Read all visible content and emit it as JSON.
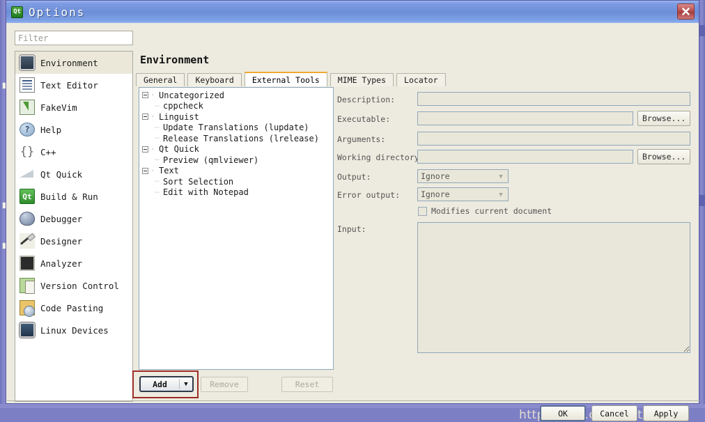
{
  "window": {
    "title": "Options",
    "app_icon": "qt-logo-icon",
    "close_label": "close-icon"
  },
  "sidebar": {
    "filter": {
      "placeholder": "Filter",
      "value": ""
    },
    "items": [
      {
        "label": "Environment",
        "icon": "environment-icon",
        "selected": true
      },
      {
        "label": "Text Editor",
        "icon": "text-editor-icon",
        "selected": false
      },
      {
        "label": "FakeVim",
        "icon": "fakevim-icon",
        "selected": false
      },
      {
        "label": "Help",
        "icon": "help-icon",
        "selected": false
      },
      {
        "label": "C++",
        "icon": "cpp-icon",
        "selected": false
      },
      {
        "label": "Qt Quick",
        "icon": "qt-quick-icon",
        "selected": false
      },
      {
        "label": "Build & Run",
        "icon": "build-run-icon",
        "selected": false
      },
      {
        "label": "Debugger",
        "icon": "debugger-icon",
        "selected": false
      },
      {
        "label": "Designer",
        "icon": "designer-icon",
        "selected": false
      },
      {
        "label": "Analyzer",
        "icon": "analyzer-icon",
        "selected": false
      },
      {
        "label": "Version Control",
        "icon": "version-control-icon",
        "selected": false
      },
      {
        "label": "Code Pasting",
        "icon": "code-pasting-icon",
        "selected": false
      },
      {
        "label": "Linux Devices",
        "icon": "linux-devices-icon",
        "selected": false
      }
    ]
  },
  "page": {
    "title": "Environment",
    "tabs": [
      {
        "label": "General",
        "active": false
      },
      {
        "label": "Keyboard",
        "active": false
      },
      {
        "label": "External Tools",
        "active": true
      },
      {
        "label": "MIME Types",
        "active": false
      },
      {
        "label": "Locator",
        "active": false
      }
    ]
  },
  "tree": {
    "nodes": [
      {
        "label": "Uncategorized",
        "level": 0
      },
      {
        "label": "cppcheck",
        "level": 1
      },
      {
        "label": "Linguist",
        "level": 0
      },
      {
        "label": "Update Translations (lupdate)",
        "level": 1
      },
      {
        "label": "Release Translations (lrelease)",
        "level": 1
      },
      {
        "label": "Qt Quick",
        "level": 0
      },
      {
        "label": "Preview (qmlviewer)",
        "level": 1
      },
      {
        "label": "Text",
        "level": 0
      },
      {
        "label": "Sort Selection",
        "level": 1
      },
      {
        "label": "Edit with Notepad",
        "level": 1
      }
    ]
  },
  "form": {
    "description": {
      "label": "Description:",
      "value": ""
    },
    "executable": {
      "label": "Executable:",
      "value": ""
    },
    "arguments": {
      "label": "Arguments:",
      "value": ""
    },
    "working_directory": {
      "label": "Working directory:",
      "value": ""
    },
    "output": {
      "label": "Output:",
      "value": "Ignore"
    },
    "error_output": {
      "label": "Error output:",
      "value": "Ignore"
    },
    "modifies_document": {
      "label": "Modifies current document",
      "checked": false
    },
    "input": {
      "label": "Input:",
      "value": ""
    },
    "browse_executable": "Browse...",
    "browse_workdir": "Browse..."
  },
  "tool_buttons": {
    "add": {
      "label": "Add",
      "enabled": true,
      "has_menu": true
    },
    "remove": {
      "label": "Remove",
      "enabled": false
    },
    "reset": {
      "label": "Reset",
      "enabled": false
    }
  },
  "footer": {
    "ok": "OK",
    "cancel": "Cancel",
    "apply": "Apply"
  },
  "watermark": {
    "text": "http://blog.csdn.net/zhMax"
  },
  "colors": {
    "titlebar": "#6c8ed8",
    "dialog_bg": "#edebdf",
    "active_tab_accent": "#f0a830",
    "highlight_box": "#9e2b26",
    "field_disabled": "#e9e7d9",
    "field_border": "#8fa6bb"
  }
}
